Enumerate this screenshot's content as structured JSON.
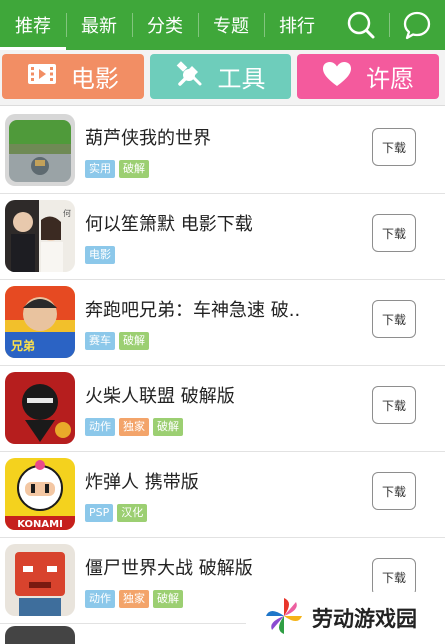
{
  "nav": {
    "tabs": [
      "推荐",
      "最新",
      "分类",
      "专题",
      "排行"
    ],
    "active_index": 0,
    "bar_color": "#3fa73a",
    "icons": [
      "search-icon",
      "chat-icon"
    ]
  },
  "categories": [
    {
      "label": "电影",
      "icon": "film-icon",
      "color": "#f28e64"
    },
    {
      "label": "工具",
      "icon": "tools-icon",
      "color": "#6ecdbb"
    },
    {
      "label": "许愿",
      "icon": "heart-icon",
      "color": "#f45a9d"
    }
  ],
  "download_label": "下载",
  "tag_colors": {
    "实用": "#8cc8ea",
    "破解": "#9ccf72",
    "电影": "#8cc8ea",
    "赛车": "#8cc8ea",
    "动作": "#8cc8ea",
    "独家": "#f3a46a",
    "PSP": "#8cc8ea",
    "汉化": "#9ccf72"
  },
  "apps": [
    {
      "title": "葫芦侠我的世界",
      "tags": [
        "实用",
        "破解"
      ]
    },
    {
      "title": "何以笙箫默  电影下载",
      "tags": [
        "电影"
      ]
    },
    {
      "title": "奔跑吧兄弟：车神急速  破..",
      "tags": [
        "赛车",
        "破解"
      ]
    },
    {
      "title": "火柴人联盟  破解版",
      "tags": [
        "动作",
        "独家",
        "破解"
      ]
    },
    {
      "title": "炸弹人  携带版",
      "tags": [
        "PSP",
        "汉化"
      ]
    },
    {
      "title": "僵尸世界大战  破解版",
      "tags": [
        "动作",
        "独家",
        "破解"
      ]
    }
  ],
  "watermark": {
    "text": "劳动游戏园"
  }
}
